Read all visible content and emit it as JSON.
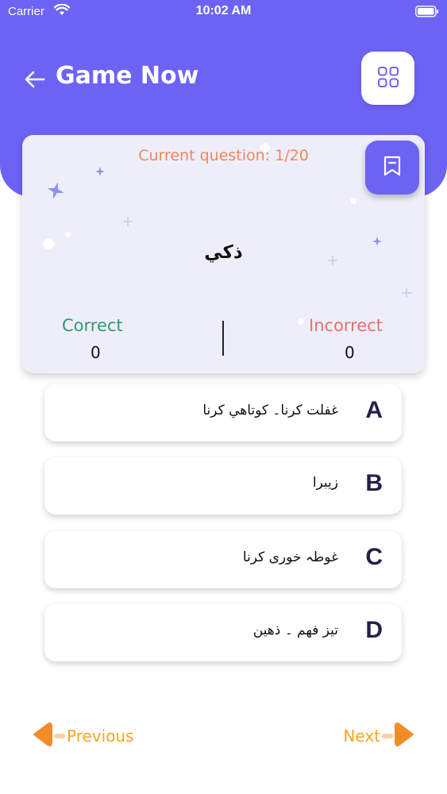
{
  "status_bar": {
    "carrier": "Carrier",
    "time": "10:02 AM"
  },
  "header": {
    "title": "Game Now",
    "back_icon": "arrow-left-icon",
    "grid_icon": "grid-icon"
  },
  "question_card": {
    "counter": "Current question: 1/20",
    "word": "ذكي",
    "correct_label": "Correct",
    "correct_value": "0",
    "incorrect_label": "Incorrect",
    "incorrect_value": "0",
    "bookmark_icon": "bookmark-icon"
  },
  "options": [
    {
      "letter": "A",
      "text": "غفلت کرنا۔ کوتاهي کرنا"
    },
    {
      "letter": "B",
      "text": "زیبرا"
    },
    {
      "letter": "C",
      "text": "غوطہ خوری کرنا"
    },
    {
      "letter": "D",
      "text": "تیز فهم ۔ ذهین"
    }
  ],
  "navigation": {
    "previous_label": "Previous",
    "next_label": "Next"
  },
  "colors": {
    "header": "#6C63F5",
    "card": "#EEEEFB",
    "counter": "#F0875A",
    "correct": "#2E9C6B",
    "incorrect": "#EC6E67",
    "nav": "#F5A623",
    "nav_arrow": "#F28C28"
  }
}
